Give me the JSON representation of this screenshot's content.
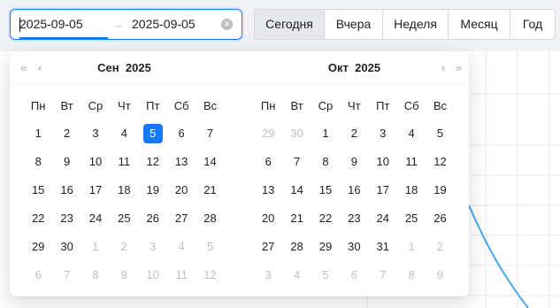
{
  "range_picker": {
    "start": "2025-09-05",
    "separator": "→",
    "end": "2025-09-05",
    "clear_icon": "close-circle-icon"
  },
  "quick_buttons": [
    {
      "label": "Сегодня",
      "active": true
    },
    {
      "label": "Вчера",
      "active": false
    },
    {
      "label": "Неделя",
      "active": false
    },
    {
      "label": "Месяц",
      "active": false
    },
    {
      "label": "Год",
      "active": false
    }
  ],
  "calendar": {
    "weekdays": [
      "Пн",
      "Вт",
      "Ср",
      "Чт",
      "Пт",
      "Сб",
      "Вс"
    ],
    "nav": {
      "super_prev": "«",
      "prev": "‹",
      "next": "›",
      "super_next": "»"
    },
    "panels": [
      {
        "month": "Сен",
        "year": "2025",
        "weeks": [
          [
            {
              "d": "1",
              "in": true
            },
            {
              "d": "2",
              "in": true
            },
            {
              "d": "3",
              "in": true
            },
            {
              "d": "4",
              "in": true
            },
            {
              "d": "5",
              "in": true,
              "selected": true
            },
            {
              "d": "6",
              "in": true
            },
            {
              "d": "7",
              "in": true
            }
          ],
          [
            {
              "d": "8",
              "in": true
            },
            {
              "d": "9",
              "in": true
            },
            {
              "d": "10",
              "in": true
            },
            {
              "d": "11",
              "in": true
            },
            {
              "d": "12",
              "in": true
            },
            {
              "d": "13",
              "in": true
            },
            {
              "d": "14",
              "in": true
            }
          ],
          [
            {
              "d": "15",
              "in": true
            },
            {
              "d": "16",
              "in": true
            },
            {
              "d": "17",
              "in": true
            },
            {
              "d": "18",
              "in": true
            },
            {
              "d": "19",
              "in": true
            },
            {
              "d": "20",
              "in": true
            },
            {
              "d": "21",
              "in": true
            }
          ],
          [
            {
              "d": "22",
              "in": true
            },
            {
              "d": "23",
              "in": true
            },
            {
              "d": "24",
              "in": true
            },
            {
              "d": "25",
              "in": true
            },
            {
              "d": "26",
              "in": true
            },
            {
              "d": "27",
              "in": true
            },
            {
              "d": "28",
              "in": true
            }
          ],
          [
            {
              "d": "29",
              "in": true
            },
            {
              "d": "30",
              "in": true
            },
            {
              "d": "1",
              "in": false
            },
            {
              "d": "2",
              "in": false
            },
            {
              "d": "3",
              "in": false
            },
            {
              "d": "4",
              "in": false
            },
            {
              "d": "5",
              "in": false
            }
          ],
          [
            {
              "d": "6",
              "in": false
            },
            {
              "d": "7",
              "in": false
            },
            {
              "d": "8",
              "in": false
            },
            {
              "d": "9",
              "in": false
            },
            {
              "d": "10",
              "in": false
            },
            {
              "d": "11",
              "in": false
            },
            {
              "d": "12",
              "in": false
            }
          ]
        ]
      },
      {
        "month": "Окт",
        "year": "2025",
        "weeks": [
          [
            {
              "d": "29",
              "in": false
            },
            {
              "d": "30",
              "in": false
            },
            {
              "d": "1",
              "in": true
            },
            {
              "d": "2",
              "in": true
            },
            {
              "d": "3",
              "in": true
            },
            {
              "d": "4",
              "in": true
            },
            {
              "d": "5",
              "in": true
            }
          ],
          [
            {
              "d": "6",
              "in": true
            },
            {
              "d": "7",
              "in": true
            },
            {
              "d": "8",
              "in": true
            },
            {
              "d": "9",
              "in": true
            },
            {
              "d": "10",
              "in": true
            },
            {
              "d": "11",
              "in": true
            },
            {
              "d": "12",
              "in": true
            }
          ],
          [
            {
              "d": "13",
              "in": true
            },
            {
              "d": "14",
              "in": true
            },
            {
              "d": "15",
              "in": true
            },
            {
              "d": "16",
              "in": true
            },
            {
              "d": "17",
              "in": true
            },
            {
              "d": "18",
              "in": true
            },
            {
              "d": "19",
              "in": true
            }
          ],
          [
            {
              "d": "20",
              "in": true
            },
            {
              "d": "21",
              "in": true
            },
            {
              "d": "22",
              "in": true
            },
            {
              "d": "23",
              "in": true
            },
            {
              "d": "24",
              "in": true
            },
            {
              "d": "25",
              "in": true
            },
            {
              "d": "26",
              "in": true
            }
          ],
          [
            {
              "d": "27",
              "in": true
            },
            {
              "d": "28",
              "in": true
            },
            {
              "d": "29",
              "in": true
            },
            {
              "d": "30",
              "in": true
            },
            {
              "d": "31",
              "in": true
            },
            {
              "d": "1",
              "in": false
            },
            {
              "d": "2",
              "in": false
            }
          ],
          [
            {
              "d": "3",
              "in": false
            },
            {
              "d": "4",
              "in": false
            },
            {
              "d": "5",
              "in": false
            },
            {
              "d": "6",
              "in": false
            },
            {
              "d": "7",
              "in": false
            },
            {
              "d": "8",
              "in": false
            },
            {
              "d": "9",
              "in": false
            }
          ]
        ]
      }
    ]
  },
  "colors": {
    "accent": "#1677ff",
    "chart_line": "#4aa8e8",
    "grid": "#e8e8e8"
  }
}
